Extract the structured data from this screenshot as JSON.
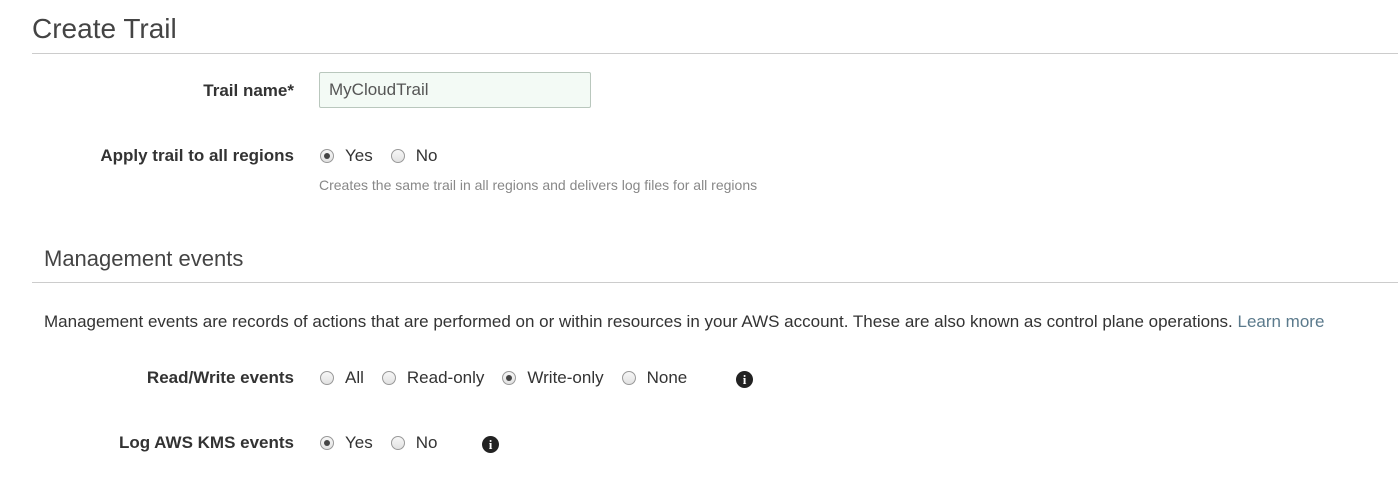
{
  "page": {
    "title": "Create Trail"
  },
  "trail_name": {
    "label": "Trail name*",
    "value": "MyCloudTrail"
  },
  "all_regions": {
    "label": "Apply trail to all regions",
    "options": [
      {
        "label": "Yes",
        "selected": true
      },
      {
        "label": "No",
        "selected": false
      }
    ],
    "help": "Creates the same trail in all regions and delivers log files for all regions"
  },
  "management_events": {
    "title": "Management events",
    "description": "Management events are records of actions that are performed on or within resources in your AWS account. These are also known as control plane operations.",
    "learn_more": "Learn more",
    "read_write": {
      "label": "Read/Write events",
      "options": [
        {
          "label": "All",
          "selected": false
        },
        {
          "label": "Read-only",
          "selected": false
        },
        {
          "label": "Write-only",
          "selected": true
        },
        {
          "label": "None",
          "selected": false
        }
      ],
      "info_icon": "info-icon"
    },
    "kms": {
      "label": "Log AWS KMS events",
      "options": [
        {
          "label": "Yes",
          "selected": true
        },
        {
          "label": "No",
          "selected": false
        }
      ],
      "info_icon": "info-icon"
    }
  },
  "colors": {
    "link": "#5b7a8c",
    "input_bg": "#f3faf5",
    "rule": "#cccccc"
  }
}
